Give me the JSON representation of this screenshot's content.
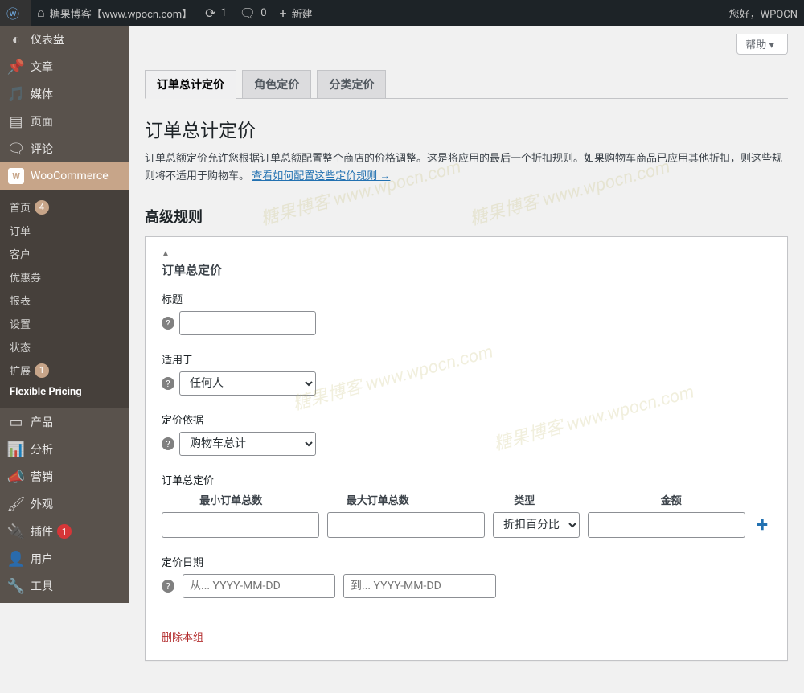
{
  "adminbar": {
    "site_title": "糖果博客【www.wpocn.com】",
    "updates": "1",
    "comments": "0",
    "new": "新建",
    "greeting": "您好，WPOCN"
  },
  "menu": {
    "dashboard": "仪表盘",
    "posts": "文章",
    "media": "媒体",
    "pages": "页面",
    "comments": "评论",
    "woocommerce": "WooCommerce",
    "submenu": {
      "home": "首页",
      "home_count": "4",
      "orders": "订单",
      "customers": "客户",
      "coupons": "优惠券",
      "reports": "报表",
      "settings": "设置",
      "status": "状态",
      "extensions": "扩展",
      "extensions_count": "1",
      "flexible": "Flexible Pricing"
    },
    "products": "产品",
    "analytics": "分析",
    "marketing": "营销",
    "appearance": "外观",
    "plugins": "插件",
    "plugins_count": "1",
    "users": "用户",
    "tools": "工具"
  },
  "screen": {
    "help": "帮助 ▾"
  },
  "tabs": {
    "tab1": "订单总计定价",
    "tab2": "角色定价",
    "tab3": "分类定价"
  },
  "main": {
    "h1": "订单总计定价",
    "desc_prefix": "订单总额定价允许您根据订单总额配置整个商店的价格调整。这是将应用的最后一个折扣规则。如果购物车商品已应用其他折扣，则这些规则将不适用于购物车。 ",
    "desc_link": "查看如何配置这些定价规则 →",
    "h2": "高级规则"
  },
  "box": {
    "title": "订单总定价",
    "label_title": "标题",
    "label_applies": "适用于",
    "applies_value": "任何人",
    "label_based": "定价依据",
    "based_value": "购物车总计",
    "totals_heading": "订单总定价",
    "col_min": "最小订单总数",
    "col_max": "最大订单总数",
    "col_type": "类型",
    "col_amount": "金额",
    "type_value": "折扣百分比",
    "label_date": "定价日期",
    "date_from_ph": "从... YYYY-MM-DD",
    "date_to_ph": "到... YYYY-MM-DD",
    "delete": "删除本组"
  },
  "watermark": "糖果博客 www.wpocn.com"
}
